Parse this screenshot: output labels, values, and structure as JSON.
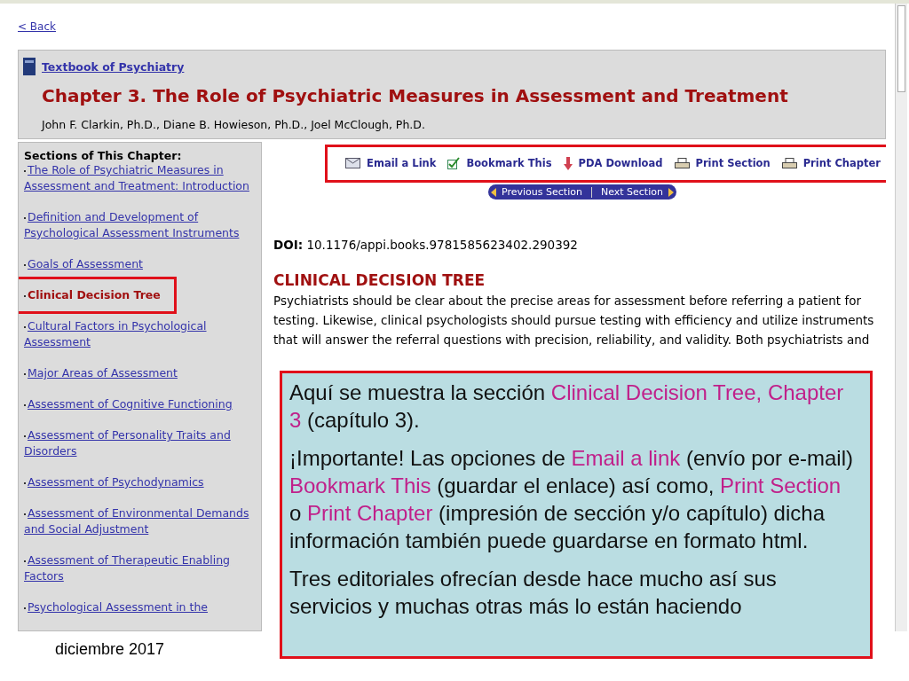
{
  "back_link": "< Back",
  "header": {
    "book_link": "Textbook of Psychiatry",
    "chapter_title": "Chapter 3. The Role of Psychiatric Measures in Assessment and Treatment",
    "authors": "John F. Clarkin, Ph.D., Diane B. Howieson, Ph.D., Joel McClough, Ph.D."
  },
  "sidebar": {
    "heading": "Sections of This Chapter:",
    "items": [
      {
        "label": "The Role of Psychiatric Measures in Assessment and Treatment: Introduction",
        "selected": false
      },
      {
        "label": "Definition and Development of Psychological Assessment Instruments",
        "selected": false
      },
      {
        "label": "Goals of Assessment",
        "selected": false
      },
      {
        "label": "Clinical Decision Tree",
        "selected": true
      },
      {
        "label": "Cultural Factors in Psychological Assessment",
        "selected": false
      },
      {
        "label": "Major Areas of Assessment",
        "selected": false
      },
      {
        "label": "Assessment of Cognitive Functioning",
        "selected": false
      },
      {
        "label": "Assessment of Personality Traits and Disorders",
        "selected": false
      },
      {
        "label": "Assessment of Psychodynamics",
        "selected": false
      },
      {
        "label": "Assessment of Environmental Demands and Social Adjustment",
        "selected": false
      },
      {
        "label": "Assessment of Therapeutic Enabling Factors",
        "selected": false
      },
      {
        "label": "Psychological Assessment in the",
        "selected": false
      }
    ]
  },
  "toolbar": [
    {
      "kind": "email",
      "label": "Email a Link"
    },
    {
      "kind": "bookmark",
      "label": "Bookmark This"
    },
    {
      "kind": "download",
      "label": "PDA Download"
    },
    {
      "kind": "print",
      "label": "Print Section"
    },
    {
      "kind": "print",
      "label": "Print Chapter"
    }
  ],
  "section_nav": [
    "Previous Section",
    "Next Section"
  ],
  "doi": {
    "label": "DOI:",
    "value": "10.1176/appi.books.9781585623402.290392"
  },
  "section_title": "CLINICAL DECISION TREE",
  "body_text": "Psychiatrists should be clear about the precise areas for assessment before referring a patient for testing. Likewise, clinical psychologists should pursue testing with efficiency and utilize instruments that will answer the referral questions with precision, reliability, and validity. Both psychiatrists and",
  "callout": {
    "paragraphs": [
      [
        {
          "text": "Aquí se muestra la sección ",
          "highlight": false
        },
        {
          "text": "Clinical Decision Tree, Chapter 3",
          "highlight": true
        },
        {
          "text": " (capítulo 3).",
          "highlight": false
        }
      ],
      [
        {
          "text": "¡Importante! Las opciones de ",
          "highlight": false
        },
        {
          "text": "Email a link",
          "highlight": true
        },
        {
          "text": " (envío por e-mail) ",
          "highlight": false
        },
        {
          "text": "Bookmark This",
          "highlight": true
        },
        {
          "text": " (guardar el enlace) así como, ",
          "highlight": false
        },
        {
          "text": "Print Section",
          "highlight": true
        },
        {
          "text": " o ",
          "highlight": false
        },
        {
          "text": "Print Chapter",
          "highlight": true
        },
        {
          "text": " (impresión de sección y/o capítulo) dicha información también puede guardarse en formato html.",
          "highlight": false
        }
      ],
      [
        {
          "text": "Tres editoriales ofrecían desde hace mucho así sus servicios y muchas otras más lo están haciendo",
          "highlight": false
        }
      ]
    ]
  },
  "footer_date": "diciembre 2017"
}
